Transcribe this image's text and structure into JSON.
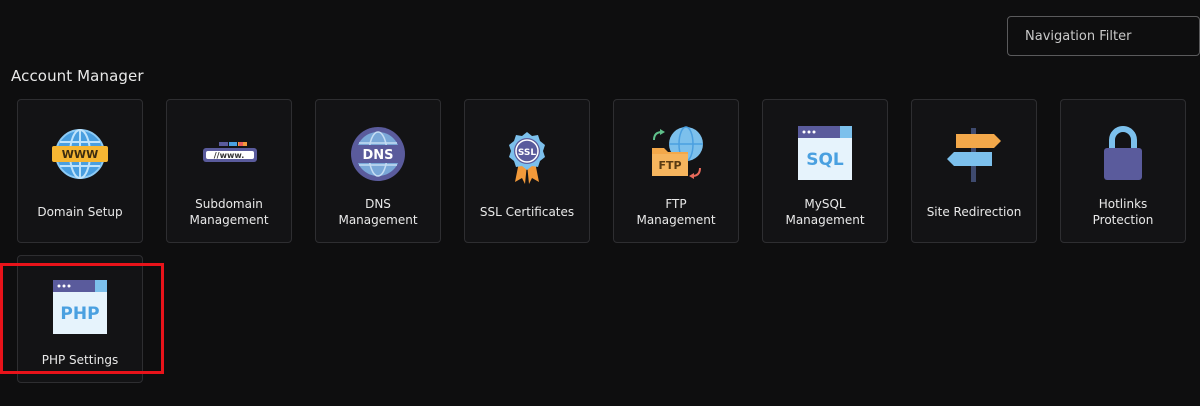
{
  "search": {
    "placeholder": "Navigation Filter"
  },
  "section": {
    "title": "Account Manager"
  },
  "tiles": [
    {
      "label": "Domain Setup",
      "icon": "globe-www-icon"
    },
    {
      "label": "Subdomain\nManagement",
      "icon": "subdomain-url-icon"
    },
    {
      "label": "DNS\nManagement",
      "icon": "dns-globe-icon"
    },
    {
      "label": "SSL Certificates",
      "icon": "ssl-badge-icon"
    },
    {
      "label": "FTP\nManagement",
      "icon": "ftp-folder-icon"
    },
    {
      "label": "MySQL\nManagement",
      "icon": "mysql-window-icon"
    },
    {
      "label": "Site Redirection",
      "icon": "signpost-icon"
    },
    {
      "label": "Hotlinks\nProtection",
      "icon": "padlock-icon"
    },
    {
      "label": "PHP Settings",
      "icon": "php-window-icon"
    }
  ],
  "icon_text": {
    "www": "WWW",
    "url": "//www.",
    "dns": "DNS",
    "ssl": "SSL",
    "ftp": "FTP",
    "sql": "SQL",
    "php": "PHP"
  },
  "colors": {
    "highlight": "#e8131a",
    "accent_blue": "#5aaeea",
    "accent_orange": "#f3a84a",
    "accent_purple": "#5a5b9c"
  }
}
